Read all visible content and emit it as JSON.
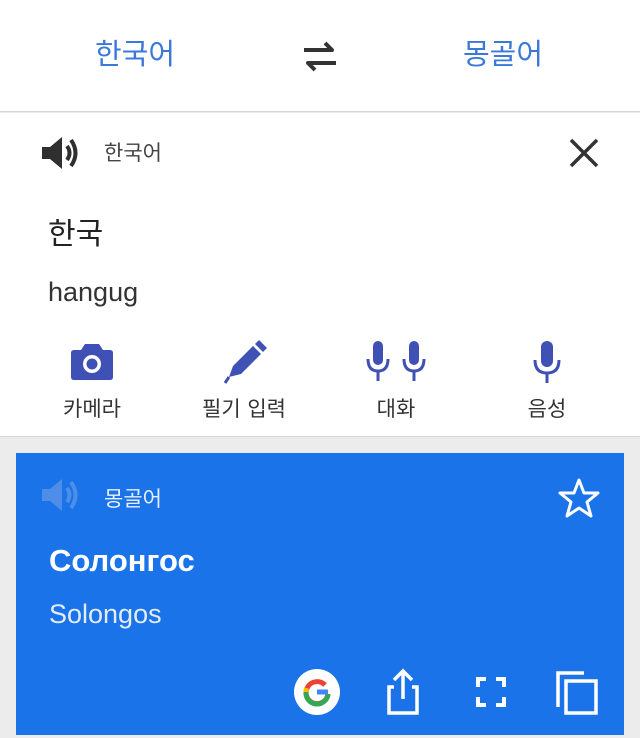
{
  "top_bar": {
    "source_language": "한국어",
    "target_language": "몽골어"
  },
  "input_card": {
    "language": "한국어",
    "source_text": "한국",
    "romanization": "hangug",
    "tools": [
      {
        "label": "카메라",
        "icon": "camera-icon"
      },
      {
        "label": "필기 입력",
        "icon": "pen-icon"
      },
      {
        "label": "대화",
        "icon": "conversation-icon"
      },
      {
        "label": "음성",
        "icon": "microphone-icon"
      }
    ]
  },
  "result_card": {
    "language": "몽골어",
    "translation": "Солонгос",
    "romanization": "Solongos",
    "actions": [
      "google-icon",
      "share-icon",
      "fullscreen-icon",
      "copy-icon"
    ]
  },
  "colors": {
    "accent": "#3b78d8",
    "tool_icon": "#3f51b5",
    "result_background": "#1a73e8",
    "background": "#ececec"
  }
}
